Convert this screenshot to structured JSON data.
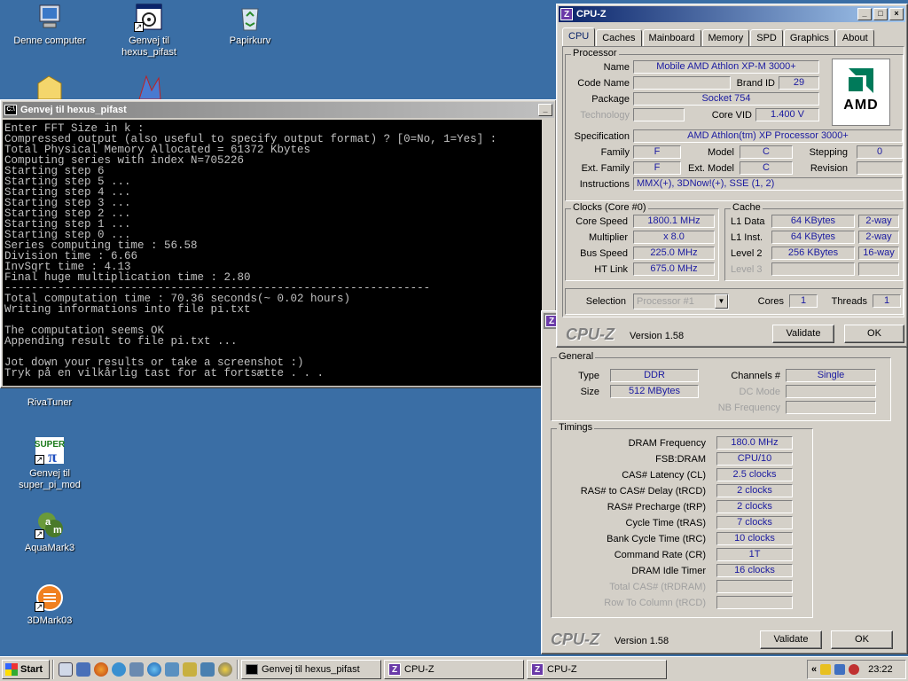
{
  "desktop": {
    "icons": [
      {
        "label1": "Denne computer",
        "label2": ""
      },
      {
        "label1": "Genvej til",
        "label2": "hexus_pifast"
      },
      {
        "label1": "Papirkurv",
        "label2": ""
      },
      {
        "label1": "RivaTuner",
        "label2": ""
      },
      {
        "label1": "Genvej til",
        "label2": "super_pi_mod"
      },
      {
        "label1": "AquaMark3",
        "label2": ""
      },
      {
        "label1": "3DMark03",
        "label2": ""
      }
    ]
  },
  "console": {
    "title": "Genvej til hexus_pifast",
    "lines": "Enter FFT Size in k :\nCompressed output (also useful to specify output format) ? [0=No, 1=Yes] :\nTotal Physical Memory Allocated = 61372 Kbytes\nComputing series with index N=705226\nStarting step 6\nStarting step 5 ...\nStarting step 4 ...\nStarting step 3 ...\nStarting step 2 ...\nStarting step 1 ...\nStarting step 0 ...\nSeries computing time : 56.58\nDivision time : 6.66\nInvSqrt time : 4.13\nFinal huge multiplication time : 2.80\n----------------------------------------------------------------\nTotal computation time : 70.36 seconds(~ 0.02 hours)\nWriting informations into file pi.txt\n\nThe computation seems OK\nAppending result to file pi.txt ...\n\nJot down your results or take a screenshot :)\nTryk på en vilkårlig tast for at fortsætte . . ."
  },
  "cpuz1": {
    "title": "CPU-Z",
    "tabs": [
      "CPU",
      "Caches",
      "Mainboard",
      "Memory",
      "SPD",
      "Graphics",
      "About"
    ],
    "processor_label": "Processor",
    "name_l": "Name",
    "name": "Mobile AMD Athlon XP-M 3000+",
    "codename_l": "Code Name",
    "codename": "",
    "brandid_l": "Brand ID",
    "brandid": "29",
    "package_l": "Package",
    "package": "Socket 754",
    "technology_l": "Technology",
    "technology": "",
    "corevid_l": "Core VID",
    "corevid": "1.400 V",
    "logo": "AMD",
    "spec_l": "Specification",
    "spec": "AMD Athlon(tm) XP Processor 3000+",
    "family_l": "Family",
    "family": "F",
    "model_l": "Model",
    "model": "C",
    "stepping_l": "Stepping",
    "stepping": "0",
    "extfamily_l": "Ext. Family",
    "extfamily": "F",
    "extmodel_l": "Ext. Model",
    "extmodel": "C",
    "revision_l": "Revision",
    "revision": "",
    "instr_l": "Instructions",
    "instr": "MMX(+), 3DNow!(+), SSE (1, 2)",
    "clocks_title": "Clocks (Core #0)",
    "corespeed_l": "Core Speed",
    "corespeed": "1800.1 MHz",
    "mult_l": "Multiplier",
    "mult": "x 8.0",
    "bus_l": "Bus Speed",
    "bus": "225.0 MHz",
    "ht_l": "HT Link",
    "ht": "675.0 MHz",
    "cache_title": "Cache",
    "l1d_l": "L1 Data",
    "l1d": "64 KBytes",
    "l1d_w": "2-way",
    "l1i_l": "L1 Inst.",
    "l1i": "64 KBytes",
    "l1i_w": "2-way",
    "l2_l": "Level 2",
    "l2": "256 KBytes",
    "l2_w": "16-way",
    "l3_l": "Level 3",
    "l3": "",
    "l3_w": "",
    "selection_l": "Selection",
    "selection": "Processor #1",
    "cores_l": "Cores",
    "cores": "1",
    "threads_l": "Threads",
    "threads": "1",
    "brand": "CPU-Z",
    "version": "Version 1.58",
    "validate": "Validate",
    "ok": "OK"
  },
  "cpuz2": {
    "general_title": "General",
    "type_l": "Type",
    "type": "DDR",
    "size_l": "Size",
    "size": "512 MBytes",
    "channels_l": "Channels #",
    "channels": "Single",
    "dcmode_l": "DC Mode",
    "dcmode": "",
    "nbfreq_l": "NB Frequency",
    "nbfreq": "",
    "timings_title": "Timings",
    "timings": [
      {
        "label": "DRAM Frequency",
        "value": "180.0 MHz",
        "dis": false
      },
      {
        "label": "FSB:DRAM",
        "value": "CPU/10",
        "dis": false
      },
      {
        "label": "CAS# Latency (CL)",
        "value": "2.5 clocks",
        "dis": false
      },
      {
        "label": "RAS# to CAS# Delay (tRCD)",
        "value": "2 clocks",
        "dis": false
      },
      {
        "label": "RAS# Precharge (tRP)",
        "value": "2 clocks",
        "dis": false
      },
      {
        "label": "Cycle Time (tRAS)",
        "value": "7 clocks",
        "dis": false
      },
      {
        "label": "Bank Cycle Time (tRC)",
        "value": "10 clocks",
        "dis": false
      },
      {
        "label": "Command Rate (CR)",
        "value": "1T",
        "dis": false
      },
      {
        "label": "DRAM Idle Timer",
        "value": "16 clocks",
        "dis": false
      },
      {
        "label": "Total CAS# (tRDRAM)",
        "value": "",
        "dis": true
      },
      {
        "label": "Row To Column (tRCD)",
        "value": "",
        "dis": true
      }
    ],
    "brand": "CPU-Z",
    "version": "Version 1.58",
    "validate": "Validate",
    "ok": "OK"
  },
  "taskbar": {
    "start": "Start",
    "tasks": [
      "Genvej til hexus_pifast",
      "CPU-Z",
      "CPU-Z"
    ],
    "tray_chevron": "«",
    "clock": "23:22"
  }
}
